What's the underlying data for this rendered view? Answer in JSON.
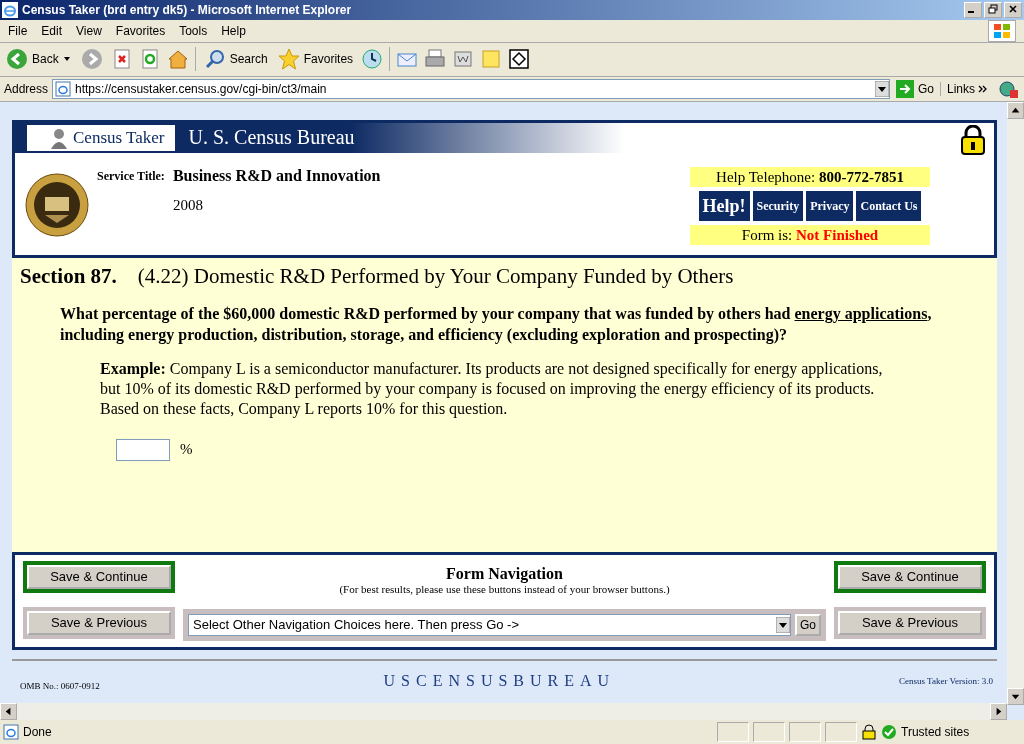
{
  "window": {
    "title": "Census Taker (brd entry dk5) - Microsoft Internet Explorer"
  },
  "menu_bar": [
    "File",
    "Edit",
    "View",
    "Favorites",
    "Tools",
    "Help"
  ],
  "toolbar": {
    "back": "Back",
    "search": "Search",
    "favorites": "Favorites"
  },
  "address_bar": {
    "label": "Address",
    "url": "https://censustaker.census.gov/cgi-bin/ct3/main",
    "go": "Go",
    "links": "Links"
  },
  "header": {
    "app_name": "Census Taker",
    "agency": "U. S. Census Bureau",
    "service_title_label": "Service Title:",
    "service_title": "Business R&D and Innovation",
    "year": "2008",
    "help_telephone_label": "Help Telephone:",
    "help_telephone": "800-772-7851",
    "help_links": [
      {
        "label": "Help!",
        "kind": "help"
      },
      {
        "label": "Security",
        "kind": "link"
      },
      {
        "label": "Privacy",
        "kind": "link"
      },
      {
        "label": "Contact Us",
        "kind": "link"
      }
    ],
    "form_status_label": "Form is:",
    "form_status": "Not Finished"
  },
  "section": {
    "number": "Section 87.",
    "title": "(4.22) Domestic R&D Performed by Your Company Funded by Others"
  },
  "question": {
    "before": "What percentage of the $60,000 domestic R&D performed by your company that was funded by others had",
    "link": "energy applications",
    "after": ", including energy production, distribution, storage, and efficiency (excluding exploration and prospecting)?"
  },
  "example": "**Example:** Company L is a semiconductor manufacturer. Its products are not designed specifically for energy applications, but 10% of its domestic R&D performed by your company is focused on improving the energy efficiency of its products. Based on these facts, Company L reports 10% for this question.",
  "answer": {
    "unit": "%"
  },
  "navigation": {
    "title": "Form Navigation",
    "note": "(For best results, please use these buttons instead of your browser buttons.)",
    "left": [
      {
        "label": "Save & Continue",
        "kind": "continue"
      },
      {
        "label": "Save & Previous",
        "kind": "previous"
      }
    ],
    "right": [
      {
        "label": "Save & Continue",
        "kind": "continue"
      },
      {
        "label": "Save & Previous",
        "kind": "previous"
      }
    ],
    "select": "Select Other Navigation Choices here. Then press Go ->",
    "go": "Go"
  },
  "footer": {
    "omb": "OMB No.: 0607-0912",
    "logo_text": "USCENSUSBUREAU",
    "version": "Census Taker Version: 3.0"
  },
  "status_bar": {
    "text": "Done",
    "zone": "Trusted sites"
  }
}
